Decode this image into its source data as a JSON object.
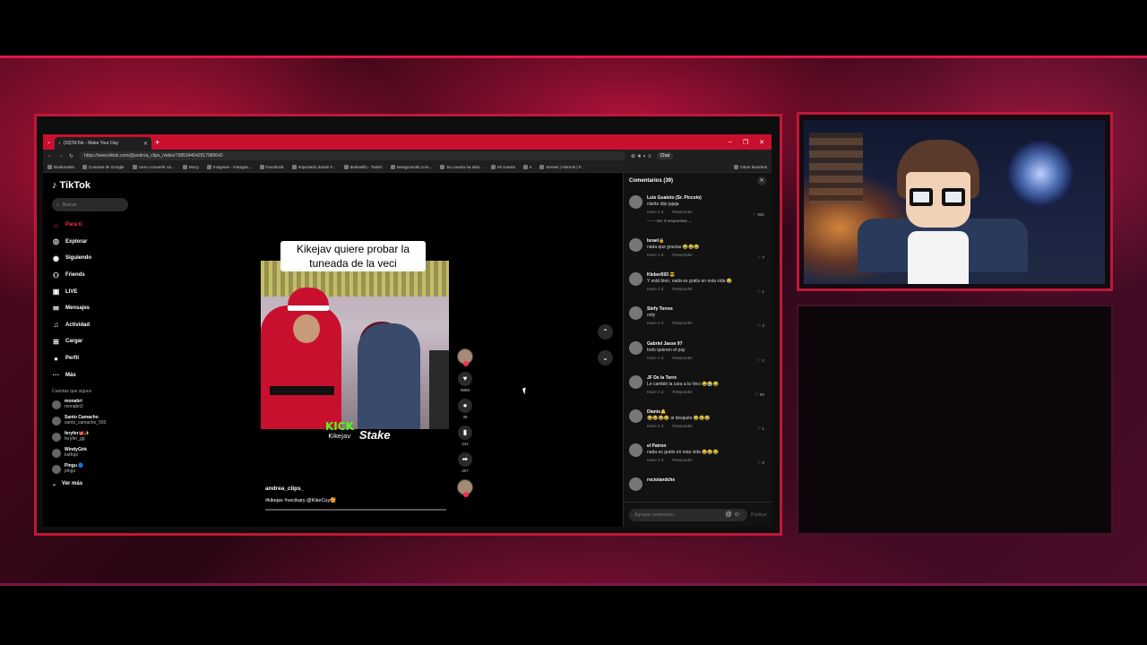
{
  "browser": {
    "tab_title": "(33)TikTok - Make Your Day",
    "url": "https://www.tiktok.com/@andrea_clips_/video/7585344042917989643",
    "chat_label": "Chat",
    "bookmarks": [
      "Bookmarks",
      "Cuentas de Google",
      "como convertir un...",
      "Muzy",
      "Insignias - Instagra...",
      "Facebook",
      "Importado desde F...",
      "dedewill2 - Twitch",
      "Newgrounds.com...",
      "Su cuenta ha sido...",
      "Mi cuenta",
      "s",
      "Sensei | Alemos | F...",
      "Otros favoritos"
    ]
  },
  "tiktok": {
    "logo": "TikTok",
    "search_placeholder": "Buscar",
    "nav": [
      {
        "label": "Para ti",
        "icon": "home-icon",
        "glyph": "⌂"
      },
      {
        "label": "Explorar",
        "icon": "compass-icon",
        "glyph": "◎"
      },
      {
        "label": "Siguiendo",
        "icon": "following-icon",
        "glyph": "◉"
      },
      {
        "label": "Friends",
        "icon": "friends-icon",
        "glyph": "⚇"
      },
      {
        "label": "LIVE",
        "icon": "live-icon",
        "glyph": "▣"
      },
      {
        "label": "Mensajes",
        "icon": "messages-icon",
        "glyph": "✉"
      },
      {
        "label": "Actividad",
        "icon": "activity-icon",
        "glyph": "♫"
      },
      {
        "label": "Cargar",
        "icon": "upload-icon",
        "glyph": "⊞"
      },
      {
        "label": "Perfil",
        "icon": "profile-icon",
        "glyph": "●"
      },
      {
        "label": "Más",
        "icon": "more-icon",
        "glyph": "···"
      }
    ],
    "following_heading": "Cuentas que sigues",
    "following": [
      {
        "name": "monabri",
        "handle": "monabri2"
      },
      {
        "name": "Santo Camacho",
        "handle": "santo_camacho_593"
      },
      {
        "name": "feryfer🐙✨",
        "handle": "feryfer_gg"
      },
      {
        "name": "WindyGirk",
        "handle": "katfopi"
      },
      {
        "name": "Pingu 🔵",
        "handle": "pingu"
      }
    ],
    "see_more": "Ver más"
  },
  "video": {
    "caption": "Kikejav quiere probar la tuneada de la veci",
    "kick_word": "KICK",
    "kick_user": "Kikejav",
    "sponsor": "Stake",
    "author": "andrea_clips_",
    "tags": "#kikejav #vecikary @KikeCuy🥰",
    "counts": {
      "likes": "6959",
      "comments": "39",
      "saves": "244",
      "shares": "407"
    }
  },
  "comments": {
    "header": "Comentarios (39)",
    "input_placeholder": "Agregar comentario...",
    "publish": "Publicar",
    "reply_label": "Responder",
    "items": [
      {
        "user": "Luis Gualoto (Sr. Piccolo)",
        "text": "clarito dijo jajaja",
        "time": "Hace 2 d",
        "likes": "991",
        "replies": "Ver 3 respuestas"
      },
      {
        "user": "Israel🔒",
        "text": "nada que gracias 😂😂😂",
        "time": "Hace 1 d",
        "likes": "7"
      },
      {
        "user": "Kleber593 😎",
        "text": "Y está bien, nada es gratis en esta vida 😂",
        "time": "Hace 2 d",
        "likes": "1"
      },
      {
        "user": "Stefy Torres",
        "text": "only",
        "time": "Hace 2 d",
        "likes": "2"
      },
      {
        "user": "Gabriel Jasse 97",
        "text": "todo quieren el pay",
        "time": "Hace 2 d",
        "likes": "1"
      },
      {
        "user": "JF De la Torre",
        "text": "Le cambió la cara a la Veci 😂😭😂",
        "time": "Hace 2 d",
        "likes": "59"
      },
      {
        "user": "Dianis🔔",
        "text": "😂😂😂😂 al desquite 😂😂😂",
        "time": "Hace 2 d",
        "likes": "1"
      },
      {
        "user": "el Patron",
        "text": "nada es gratis en esta vida 😂😂😂",
        "time": "Hace 2 d",
        "likes": "0"
      },
      {
        "user": "rocioiandche",
        "text": "",
        "time": "",
        "likes": ""
      }
    ]
  },
  "colors": {
    "accent": "#c8102e",
    "tiktok_red": "#fe2c55",
    "kick_green": "#53fc18"
  }
}
